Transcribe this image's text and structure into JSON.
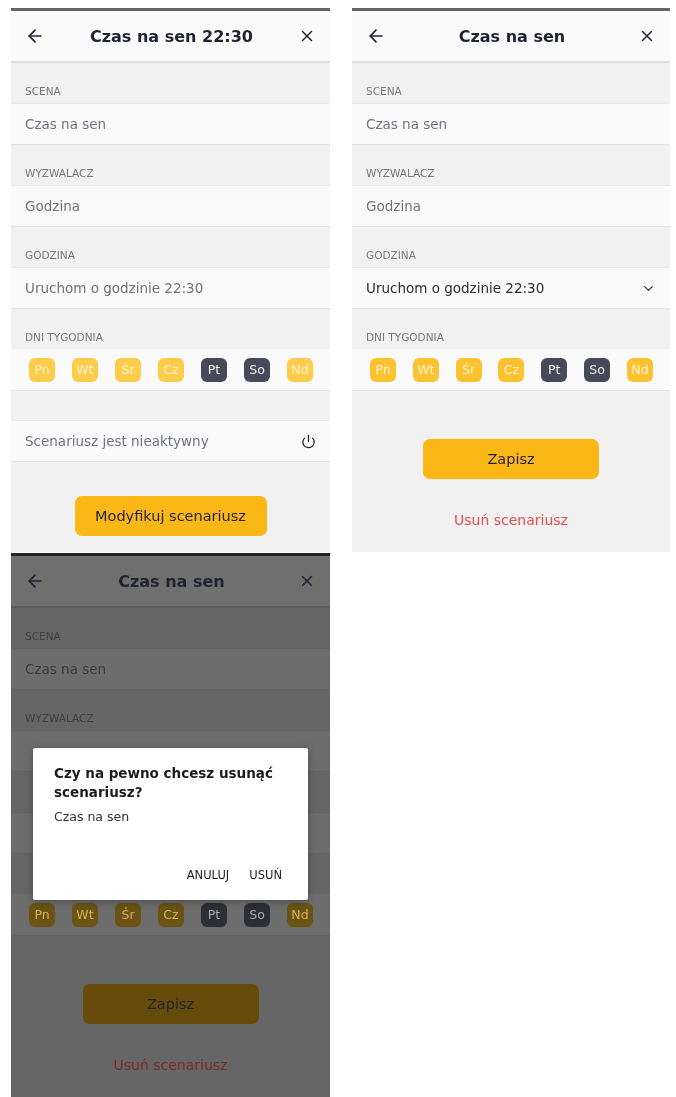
{
  "screens": [
    {
      "title": "Czas na sen 22:30",
      "dimmed": false,
      "sections": [
        {
          "label": "SCENA",
          "value": "Czas na sen",
          "kind": "text"
        },
        {
          "label": "WYZWALACZ",
          "value": "Godzina",
          "kind": "text"
        },
        {
          "label": "GODZINA",
          "value": "Uruchom o godzinie 22:30",
          "kind": "text"
        }
      ],
      "days_label": "DNI TYGODNIA",
      "days_muted": true,
      "days": [
        {
          "label": "Pn",
          "selected": true
        },
        {
          "label": "Wt",
          "selected": true
        },
        {
          "label": "Śr",
          "selected": true
        },
        {
          "label": "Cz",
          "selected": true
        },
        {
          "label": "Pt",
          "selected": false
        },
        {
          "label": "So",
          "selected": false
        },
        {
          "label": "Nd",
          "selected": true
        }
      ],
      "status": "Scenariusz jest nieaktywny",
      "primary_button": "Modyfikuj scenariusz"
    },
    {
      "title": "Czas na sen",
      "dimmed": false,
      "sections": [
        {
          "label": "SCENA",
          "value": "Czas na sen",
          "kind": "text"
        },
        {
          "label": "WYZWALACZ",
          "value": "Godzina",
          "kind": "text"
        },
        {
          "label": "GODZINA",
          "value": "Uruchom o godzinie 22:30",
          "kind": "dropdown"
        }
      ],
      "days_label": "DNI TYGODNIA",
      "days_muted": false,
      "days": [
        {
          "label": "Pn",
          "selected": true
        },
        {
          "label": "Wt",
          "selected": true
        },
        {
          "label": "Śr",
          "selected": true
        },
        {
          "label": "Cz",
          "selected": true
        },
        {
          "label": "Pt",
          "selected": false
        },
        {
          "label": "So",
          "selected": false
        },
        {
          "label": "Nd",
          "selected": true
        }
      ],
      "primary_button": "Zapisz",
      "delete_link": "Usuń scenariusz"
    },
    {
      "title": "Czas na sen",
      "dimmed": true,
      "sections": [
        {
          "label": "SCENA",
          "value": "Czas na sen",
          "kind": "text"
        },
        {
          "label": "WYZWALACZ",
          "kind": "covered"
        },
        {
          "kind": "covered"
        }
      ],
      "days_muted": false,
      "days": [
        {
          "label": "Pn",
          "selected": true
        },
        {
          "label": "Wt",
          "selected": true
        },
        {
          "label": "Śr",
          "selected": true
        },
        {
          "label": "Cz",
          "selected": true
        },
        {
          "label": "Pt",
          "selected": false
        },
        {
          "label": "So",
          "selected": false
        },
        {
          "label": "Nd",
          "selected": true
        }
      ],
      "primary_button": "Zapisz",
      "delete_link": "Usuń scenariusz",
      "dialog": {
        "title": "Czy na pewno chcesz usunąć scenariusz?",
        "message": "Czas na sen",
        "buttons": [
          "ANULUJ",
          "USUŃ"
        ]
      }
    }
  ]
}
